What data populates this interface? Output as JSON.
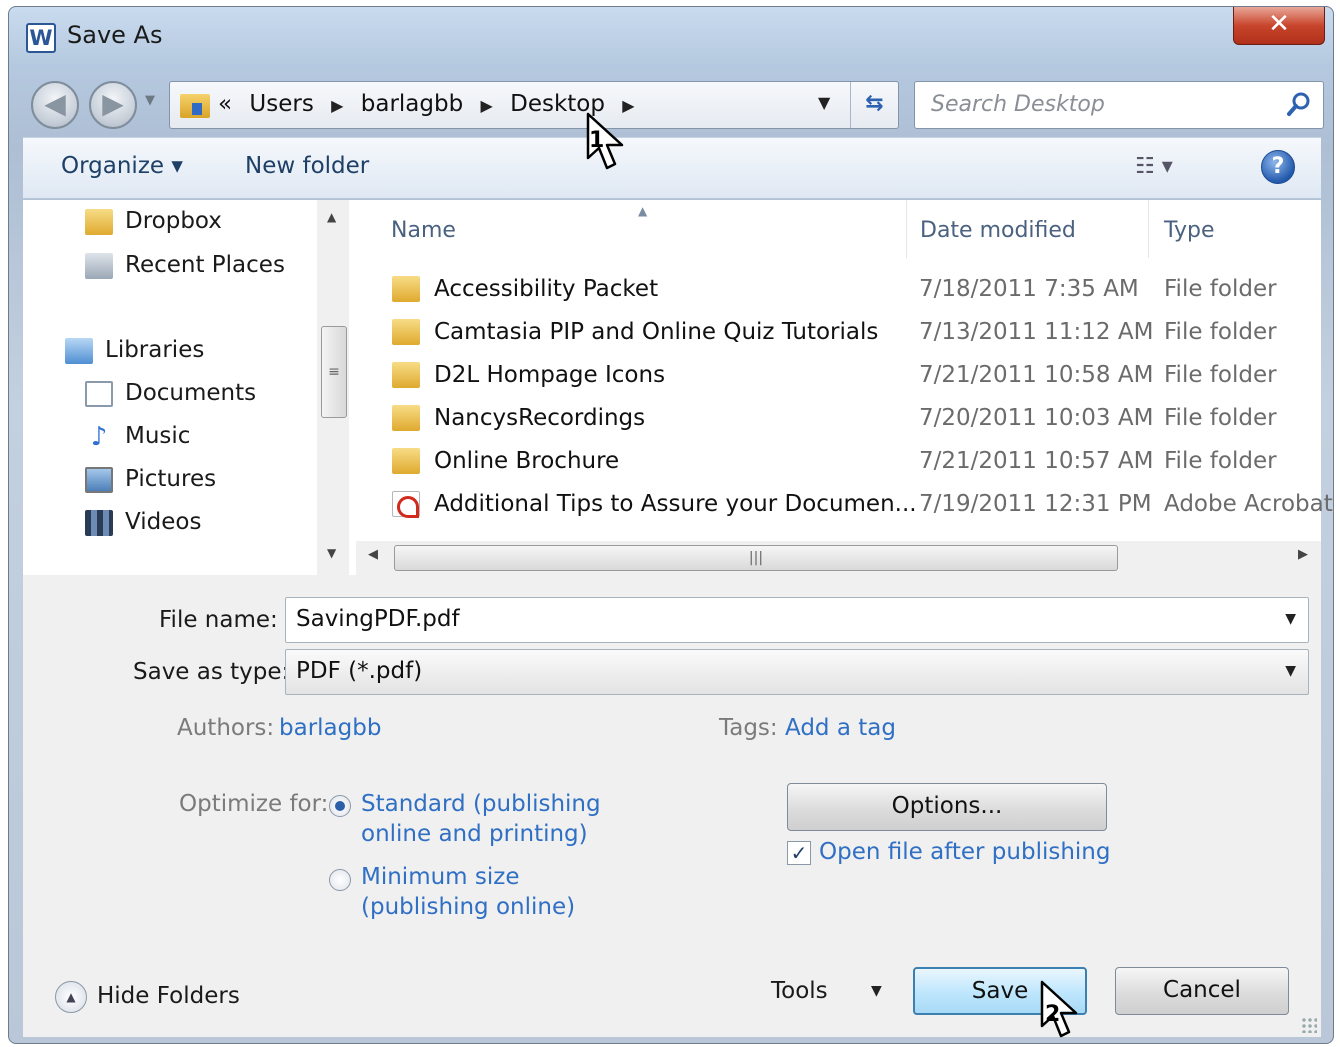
{
  "window": {
    "title": "Save As",
    "app_icon_letter": "W",
    "close_glyph": "✕"
  },
  "nav": {
    "breadcrumbs": [
      "Users",
      "barlagbb",
      "Desktop"
    ],
    "overflow": "«",
    "search_placeholder": "Search Desktop"
  },
  "toolbar": {
    "organize": "Organize ▾",
    "new_folder": "New folder",
    "view_glyph": "☷ ▾",
    "help_glyph": "?"
  },
  "sidebar": {
    "items": [
      {
        "label": "Dropbox",
        "icon": "folder-icon"
      },
      {
        "label": "Recent Places",
        "icon": "recent-places-icon"
      },
      {
        "label": "Libraries",
        "icon": "libraries-icon"
      },
      {
        "label": "Documents",
        "icon": "documents-icon"
      },
      {
        "label": "Music",
        "icon": "music-icon"
      },
      {
        "label": "Pictures",
        "icon": "pictures-icon"
      },
      {
        "label": "Videos",
        "icon": "videos-icon"
      }
    ]
  },
  "files": {
    "columns": [
      "Name",
      "Date modified",
      "Type"
    ],
    "rows": [
      {
        "name": "Accessibility Packet",
        "date": "7/18/2011 7:35 AM",
        "type": "File folder",
        "icon": "folder-icon"
      },
      {
        "name": "Camtasia  PIP and Online Quiz Tutorials",
        "date": "7/13/2011 11:12 AM",
        "type": "File folder",
        "icon": "folder-icon"
      },
      {
        "name": "D2L Hompage Icons",
        "date": "7/21/2011 10:58 AM",
        "type": "File folder",
        "icon": "folder-icon"
      },
      {
        "name": "NancysRecordings",
        "date": "7/20/2011 10:03 AM",
        "type": "File folder",
        "icon": "folder-icon"
      },
      {
        "name": "Online Brochure",
        "date": "7/21/2011 10:57 AM",
        "type": "File folder",
        "icon": "folder-icon"
      },
      {
        "name": "Additional Tips to Assure your Documen...",
        "date": "7/19/2011 12:31 PM",
        "type": "Adobe Acrobat",
        "icon": "pdf-icon"
      }
    ]
  },
  "form": {
    "file_name_label": "File name:",
    "file_name_value": "SavingPDF.pdf",
    "save_type_label": "Save as type:",
    "save_type_value": "PDF (*.pdf)",
    "authors_label": "Authors:",
    "authors_value": "barlagbb",
    "tags_label": "Tags:",
    "tags_value": "Add a tag",
    "optimize_label": "Optimize for:",
    "option_standard_line1": "Standard (publishing",
    "option_standard_line2": "online and printing)",
    "option_minimum_line1": "Minimum size",
    "option_minimum_line2": "(publishing online)",
    "selected_option": "Standard (publishing online and printing)",
    "options_button": "Options...",
    "open_after_label": "Open file after publishing",
    "open_after_checked": true
  },
  "footer": {
    "hide_folders": "Hide Folders",
    "tools": "Tools",
    "save": "Save",
    "cancel": "Cancel"
  },
  "annotations": {
    "step1": "1",
    "step2": "2"
  }
}
